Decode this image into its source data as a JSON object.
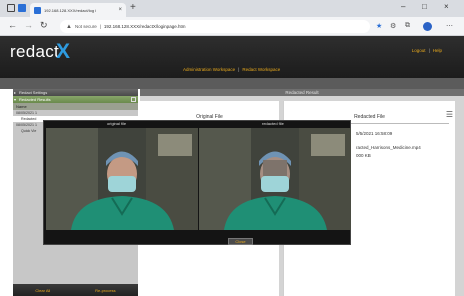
{
  "browser": {
    "tab_title": "192.168.128.XXX/redact/log i",
    "new_tab_symbol": "+",
    "url": "192.168.128.XXX/redactX/loginpage.htm",
    "not_secure": "Not secure",
    "window_controls": [
      "–",
      "□",
      "×"
    ],
    "icons": [
      "back-icon",
      "forward-icon",
      "reload-icon",
      "lock-icon",
      "star-icon",
      "extensions-icon",
      "collections-icon",
      "profile-icon"
    ]
  },
  "app": {
    "logo_text": "redact",
    "logo_mark": "X",
    "header_links": [
      "Logout",
      "Help"
    ],
    "header_nav": [
      "Administration Workspace",
      "Redact Workspace"
    ],
    "brand_color": "#2e9be0",
    "accent_color": "#e8a91c"
  },
  "sidebar": {
    "sections": [
      {
        "label": "Redact Settings",
        "open": false
      },
      {
        "label": "Redacted Results",
        "open": true
      }
    ],
    "column_header": "Name",
    "rows": [
      {
        "text": "08/05/2021 1",
        "selected": false,
        "indent": false
      },
      {
        "text": "Redacted",
        "selected": true,
        "indent": true
      },
      {
        "text": "08/05/2021 1",
        "selected": false,
        "indent": false
      },
      {
        "text": "Quick Vie",
        "selected": false,
        "indent": true
      }
    ],
    "footer_buttons": [
      "Clear All",
      "Re-process"
    ]
  },
  "main": {
    "title": "Redacted Result",
    "left_panel_title": "Original File",
    "right_panel_title": "Redacted File",
    "info_lines": [
      "5/5/2021 16:58:09",
      "racted_Harrisons_Medicine.mp4",
      "000 KB"
    ]
  },
  "modal": {
    "left_title": "original file",
    "right_title": "redacted file",
    "close_label": "Close"
  }
}
